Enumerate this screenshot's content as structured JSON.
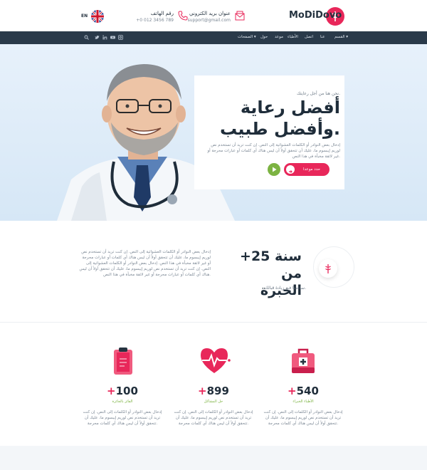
{
  "header": {
    "logo_text": "MoDiDovo",
    "email_label": "عنوان بريد الكتروني",
    "email_value": "support@gmail.com",
    "phone_label": "رقم الهاتف",
    "phone_value": "+0 012 3456 789",
    "lang_label": "EN"
  },
  "nav": {
    "items": [
      "القسم ▾",
      "عنا",
      "اتصل",
      "الأطباء",
      "موعد",
      "حول",
      "الصفحات ▾"
    ],
    "social": [
      "f",
      "t",
      "in",
      "yt",
      "ig",
      "search"
    ]
  },
  "hero": {
    "small": "نحن هنا من أجل رعايتك.",
    "title_line1": "أفضل رعاية",
    "title_line2": "وأفضل طبيب.",
    "text": "إدخال بعض النوادر أو الكلمات العشوائية إلى النص. إن كنت تريد أن تستخدم نص لوريم إيبسوم ما، عليك أن تتحقق أولاً أن ليس هناك أي كلمات أو عبارات محرجة أو غير لائقة مخبأة في هذا النص.",
    "button_label": "حدد موعدا"
  },
  "experience": {
    "title_line1": "+25 سنة من",
    "title_line2": "الخبرة",
    "note": "ساعدنا في زيادة قبالك.",
    "text": "إدخال بعض النوادر أو الكلمات العشوائية إلى النص. إن كنت تريد أن تستخدم نص لوريم إيبسوم ما، عليك أن تتحقق أولاً أن ليس هناك أي كلمات أو عبارات محرجة أو غير لائقة مخبأة في هذا النص. إدخال بعض النوادر أو الكلمات العشوائية إلى النص. إن كنت تريد أن تستخدم نص لوريم إيبسوم ما، عليك أن تتحقق أولاً أن ليس هناك أي كلمات أو عبارات محرجة أو غير لائقة مخبأة في هذا النص."
  },
  "stats": [
    {
      "icon": "first-aid-kit-icon",
      "number": "540",
      "plus": "+",
      "label": "الأطباء الخبراء",
      "text": "إدخال بعض النوادر أو الكلمات إلى النص. إن كنت تريد أن تستخدم نص لوريم إيبسوم ما، عليك أن تتحقق أولاً أن ليس هناك أي كلمات محرجة."
    },
    {
      "icon": "heart-pulse-icon",
      "number": "899",
      "plus": "+",
      "label": "حل المشاكل",
      "text": "إدخال بعض النوادر أو الكلمات إلى النص. إن كنت تريد أن تستخدم نص لوريم إيبسوم ما، عليك أن تتحقق أولاً أن ليس هناك أي كلمات محرجة."
    },
    {
      "icon": "clipboard-icon",
      "number": "100",
      "plus": "+",
      "label": "الفائز بالجائزة",
      "text": "إدخال بعض النوادر أو الكلمات إلى النص. إن كنت تريد أن تستخدم نص لوريم إيبسوم ما، عليك أن تتحقق أولاً أن ليس هناك أي كلمات محرجة."
    }
  ],
  "colors": {
    "accent": "#e8275a",
    "green": "#7cb342",
    "navy": "#2a3a4a"
  }
}
